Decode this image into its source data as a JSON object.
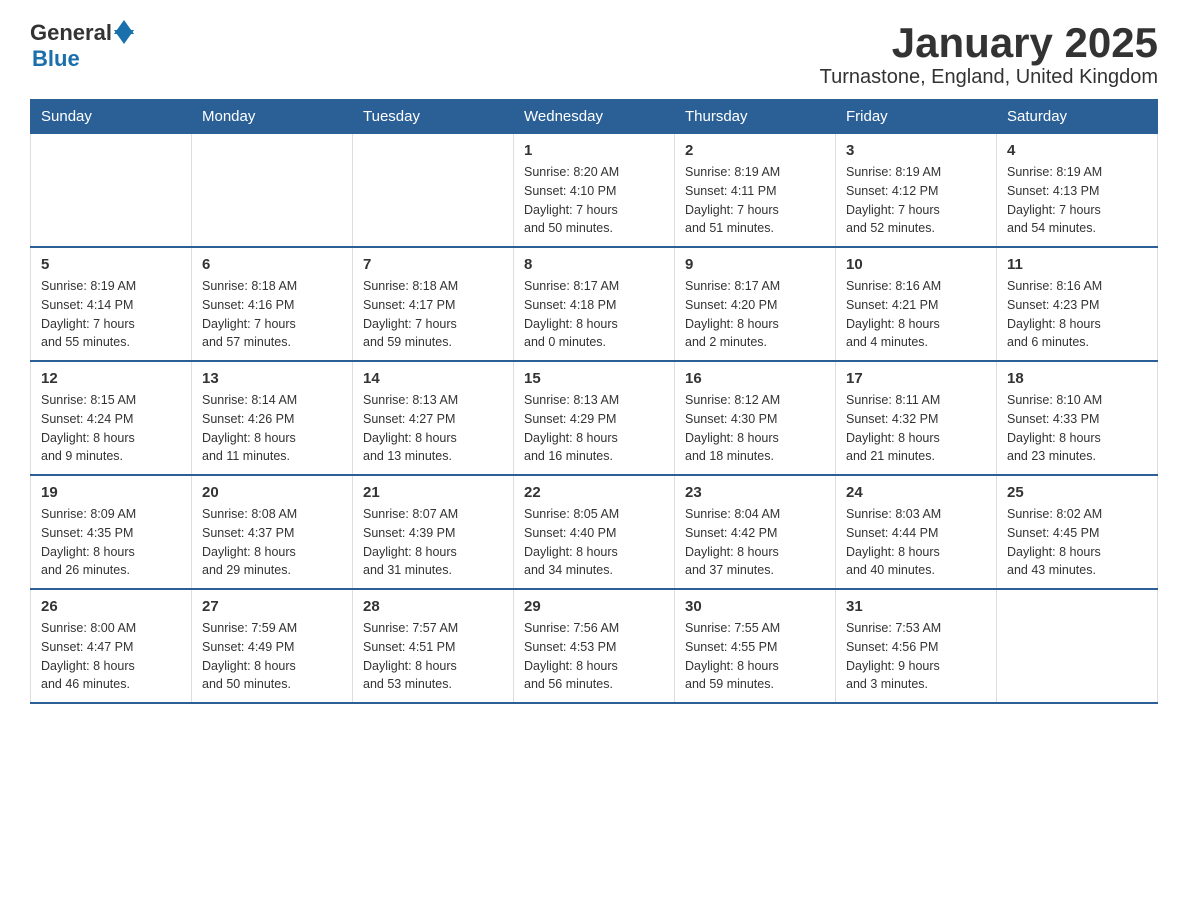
{
  "header": {
    "logo": {
      "text_general": "General",
      "text_blue": "Blue"
    },
    "title": "January 2025",
    "subtitle": "Turnastone, England, United Kingdom"
  },
  "weekdays": [
    "Sunday",
    "Monday",
    "Tuesday",
    "Wednesday",
    "Thursday",
    "Friday",
    "Saturday"
  ],
  "weeks": [
    [
      {
        "day": "",
        "info": ""
      },
      {
        "day": "",
        "info": ""
      },
      {
        "day": "",
        "info": ""
      },
      {
        "day": "1",
        "info": "Sunrise: 8:20 AM\nSunset: 4:10 PM\nDaylight: 7 hours\nand 50 minutes."
      },
      {
        "day": "2",
        "info": "Sunrise: 8:19 AM\nSunset: 4:11 PM\nDaylight: 7 hours\nand 51 minutes."
      },
      {
        "day": "3",
        "info": "Sunrise: 8:19 AM\nSunset: 4:12 PM\nDaylight: 7 hours\nand 52 minutes."
      },
      {
        "day": "4",
        "info": "Sunrise: 8:19 AM\nSunset: 4:13 PM\nDaylight: 7 hours\nand 54 minutes."
      }
    ],
    [
      {
        "day": "5",
        "info": "Sunrise: 8:19 AM\nSunset: 4:14 PM\nDaylight: 7 hours\nand 55 minutes."
      },
      {
        "day": "6",
        "info": "Sunrise: 8:18 AM\nSunset: 4:16 PM\nDaylight: 7 hours\nand 57 minutes."
      },
      {
        "day": "7",
        "info": "Sunrise: 8:18 AM\nSunset: 4:17 PM\nDaylight: 7 hours\nand 59 minutes."
      },
      {
        "day": "8",
        "info": "Sunrise: 8:17 AM\nSunset: 4:18 PM\nDaylight: 8 hours\nand 0 minutes."
      },
      {
        "day": "9",
        "info": "Sunrise: 8:17 AM\nSunset: 4:20 PM\nDaylight: 8 hours\nand 2 minutes."
      },
      {
        "day": "10",
        "info": "Sunrise: 8:16 AM\nSunset: 4:21 PM\nDaylight: 8 hours\nand 4 minutes."
      },
      {
        "day": "11",
        "info": "Sunrise: 8:16 AM\nSunset: 4:23 PM\nDaylight: 8 hours\nand 6 minutes."
      }
    ],
    [
      {
        "day": "12",
        "info": "Sunrise: 8:15 AM\nSunset: 4:24 PM\nDaylight: 8 hours\nand 9 minutes."
      },
      {
        "day": "13",
        "info": "Sunrise: 8:14 AM\nSunset: 4:26 PM\nDaylight: 8 hours\nand 11 minutes."
      },
      {
        "day": "14",
        "info": "Sunrise: 8:13 AM\nSunset: 4:27 PM\nDaylight: 8 hours\nand 13 minutes."
      },
      {
        "day": "15",
        "info": "Sunrise: 8:13 AM\nSunset: 4:29 PM\nDaylight: 8 hours\nand 16 minutes."
      },
      {
        "day": "16",
        "info": "Sunrise: 8:12 AM\nSunset: 4:30 PM\nDaylight: 8 hours\nand 18 minutes."
      },
      {
        "day": "17",
        "info": "Sunrise: 8:11 AM\nSunset: 4:32 PM\nDaylight: 8 hours\nand 21 minutes."
      },
      {
        "day": "18",
        "info": "Sunrise: 8:10 AM\nSunset: 4:33 PM\nDaylight: 8 hours\nand 23 minutes."
      }
    ],
    [
      {
        "day": "19",
        "info": "Sunrise: 8:09 AM\nSunset: 4:35 PM\nDaylight: 8 hours\nand 26 minutes."
      },
      {
        "day": "20",
        "info": "Sunrise: 8:08 AM\nSunset: 4:37 PM\nDaylight: 8 hours\nand 29 minutes."
      },
      {
        "day": "21",
        "info": "Sunrise: 8:07 AM\nSunset: 4:39 PM\nDaylight: 8 hours\nand 31 minutes."
      },
      {
        "day": "22",
        "info": "Sunrise: 8:05 AM\nSunset: 4:40 PM\nDaylight: 8 hours\nand 34 minutes."
      },
      {
        "day": "23",
        "info": "Sunrise: 8:04 AM\nSunset: 4:42 PM\nDaylight: 8 hours\nand 37 minutes."
      },
      {
        "day": "24",
        "info": "Sunrise: 8:03 AM\nSunset: 4:44 PM\nDaylight: 8 hours\nand 40 minutes."
      },
      {
        "day": "25",
        "info": "Sunrise: 8:02 AM\nSunset: 4:45 PM\nDaylight: 8 hours\nand 43 minutes."
      }
    ],
    [
      {
        "day": "26",
        "info": "Sunrise: 8:00 AM\nSunset: 4:47 PM\nDaylight: 8 hours\nand 46 minutes."
      },
      {
        "day": "27",
        "info": "Sunrise: 7:59 AM\nSunset: 4:49 PM\nDaylight: 8 hours\nand 50 minutes."
      },
      {
        "day": "28",
        "info": "Sunrise: 7:57 AM\nSunset: 4:51 PM\nDaylight: 8 hours\nand 53 minutes."
      },
      {
        "day": "29",
        "info": "Sunrise: 7:56 AM\nSunset: 4:53 PM\nDaylight: 8 hours\nand 56 minutes."
      },
      {
        "day": "30",
        "info": "Sunrise: 7:55 AM\nSunset: 4:55 PM\nDaylight: 8 hours\nand 59 minutes."
      },
      {
        "day": "31",
        "info": "Sunrise: 7:53 AM\nSunset: 4:56 PM\nDaylight: 9 hours\nand 3 minutes."
      },
      {
        "day": "",
        "info": ""
      }
    ]
  ]
}
